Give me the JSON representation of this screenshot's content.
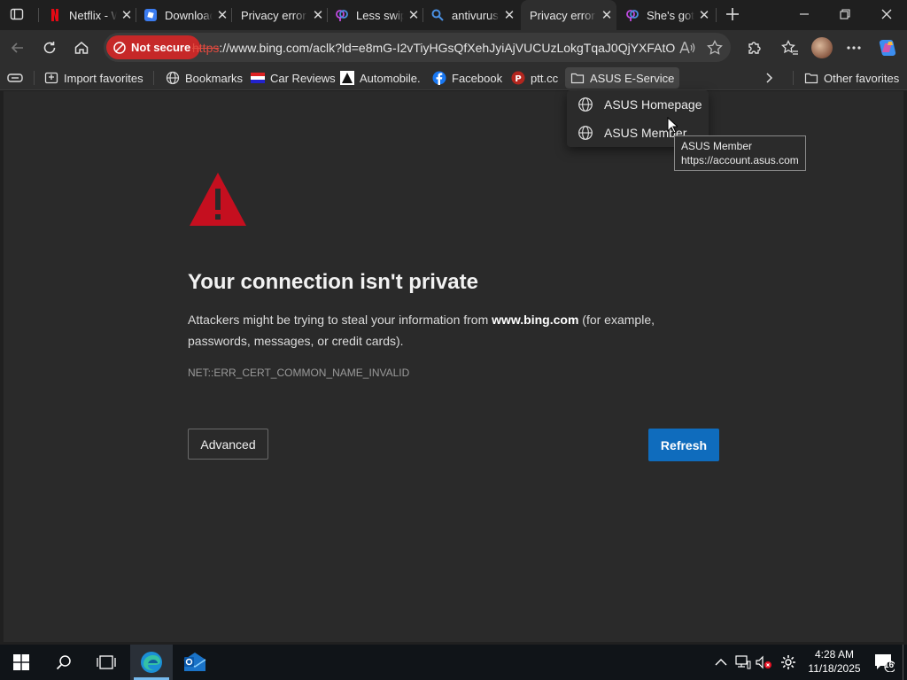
{
  "tabs": [
    {
      "label": "Netflix - W",
      "icon": "netflix-icon"
    },
    {
      "label": "Download",
      "icon": "roblox-icon"
    },
    {
      "label": "Privacy error",
      "icon": "none"
    },
    {
      "label": "Less swip",
      "icon": "dating-icon"
    },
    {
      "label": "antivurus",
      "icon": "search-icon"
    },
    {
      "label": "Privacy error",
      "icon": "none",
      "active": true
    },
    {
      "label": "She's got",
      "icon": "dating-icon"
    }
  ],
  "address_bar": {
    "security_label": "Not secure",
    "url_scheme": "https",
    "url_rest": "://www.bing.com/aclk?ld=e8mG-I2vTiyHGsQfXehJyiAjVUCUzLokgTqaJ0QjYXFAtO..."
  },
  "bookmarks": [
    {
      "label": "Import favorites",
      "icon": "import-icon"
    },
    {
      "label": "Bookmarks",
      "icon": "globe-icon"
    },
    {
      "label": "Car Reviews",
      "icon": "flag-icon"
    },
    {
      "label": "Automobile.",
      "icon": "automobile-icon"
    },
    {
      "label": "Facebook",
      "icon": "facebook-icon"
    },
    {
      "label": "ptt.cc",
      "icon": "ptt-icon"
    },
    {
      "label": "ASUS E-Service",
      "icon": "folder-icon"
    }
  ],
  "other_favorites": "Other favorites",
  "folder_menu": {
    "items": [
      "ASUS Homepage",
      "ASUS Member"
    ]
  },
  "tooltip": {
    "title": "ASUS Member",
    "url": "https://account.asus.com"
  },
  "error_page": {
    "title": "Your connection isn't private",
    "body_before": "Attackers might be trying to steal your information from ",
    "body_host": "www.bing.com",
    "body_after": " (for example, passwords, messages, or credit cards).",
    "error_code": "NET::ERR_CERT_COMMON_NAME_INVALID",
    "advanced_label": "Advanced",
    "refresh_label": "Refresh"
  },
  "taskbar": {
    "time": "4:28 AM",
    "date": "11/18/2025",
    "notification_count": "16"
  },
  "colors": {
    "accent": "#0f6cbd",
    "warning": "#c62828",
    "danger_red": "#e81123"
  }
}
